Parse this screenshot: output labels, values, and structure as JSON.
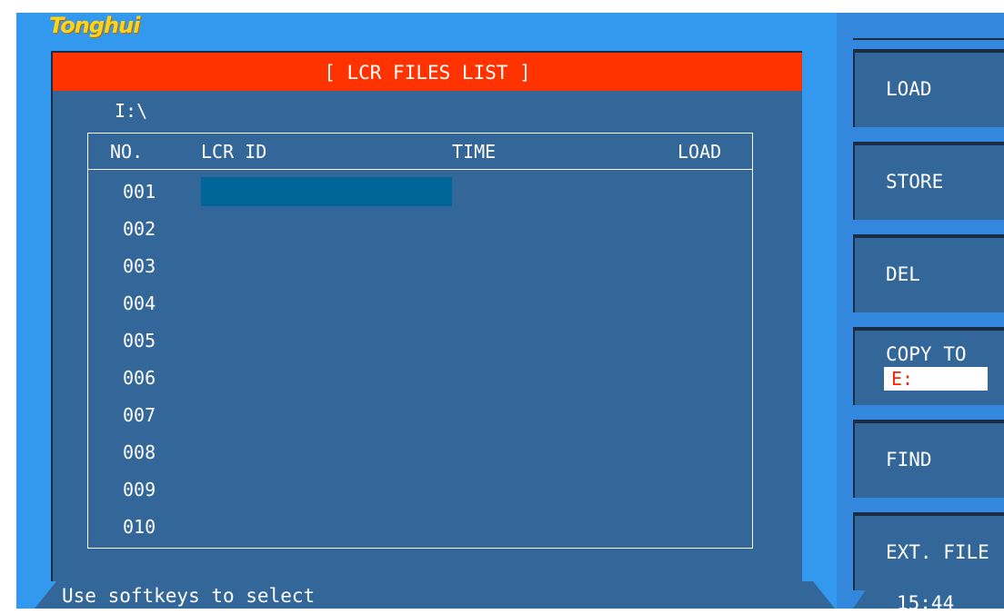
{
  "brand": "Tonghui",
  "title": "[ LCR FILES LIST ]",
  "path": "I:\\",
  "columns": {
    "no": "NO.",
    "lcr_id": "LCR ID",
    "time": "TIME",
    "load": "LOAD"
  },
  "rows": [
    "001",
    "002",
    "003",
    "004",
    "005",
    "006",
    "007",
    "008",
    "009",
    "010"
  ],
  "softkeys": {
    "load": "LOAD",
    "store": "STORE",
    "del": "DEL",
    "copy_to": "COPY TO",
    "copy_to_value": "E:",
    "find": "FIND",
    "ext_file": "EXT. FILE"
  },
  "status": "Use softkeys to select",
  "clock": "15:44",
  "colors": {
    "title_bar": "#ff3300",
    "panel": "#336699",
    "frame": "#3399ee",
    "cursor": "#006699",
    "copy_value_text": "#ff2200"
  }
}
